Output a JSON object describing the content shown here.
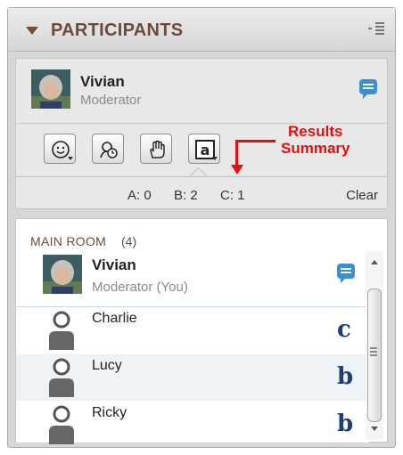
{
  "panel": {
    "title": "PARTICIPANTS"
  },
  "me": {
    "name": "Vivian",
    "role": "Moderator"
  },
  "toolbar": {
    "buttons": [
      "emoticon-icon",
      "away-clock-icon",
      "raise-hand-icon",
      "answer-letter-icon"
    ],
    "answer_glyph": "a"
  },
  "results": {
    "a_label": "A: 0",
    "b_label": "B: 2",
    "c_label": "C: 1",
    "clear_label": "Clear"
  },
  "annotation": {
    "line1": "Results",
    "line2": "Summary",
    "color": "#e01010"
  },
  "room": {
    "title": "MAIN ROOM",
    "count": "(4)",
    "participants": [
      {
        "name": "Vivian",
        "role": "Moderator (You)",
        "answer": ""
      },
      {
        "name": "Charlie",
        "role": "",
        "answer": "c"
      },
      {
        "name": "Lucy",
        "role": "",
        "answer": "b"
      },
      {
        "name": "Ricky",
        "role": "",
        "answer": "b"
      }
    ]
  },
  "colors": {
    "accent_brown": "#6b4b3a",
    "answer_blue": "#1f3f78",
    "chat_blue": "#3b8ed9"
  }
}
